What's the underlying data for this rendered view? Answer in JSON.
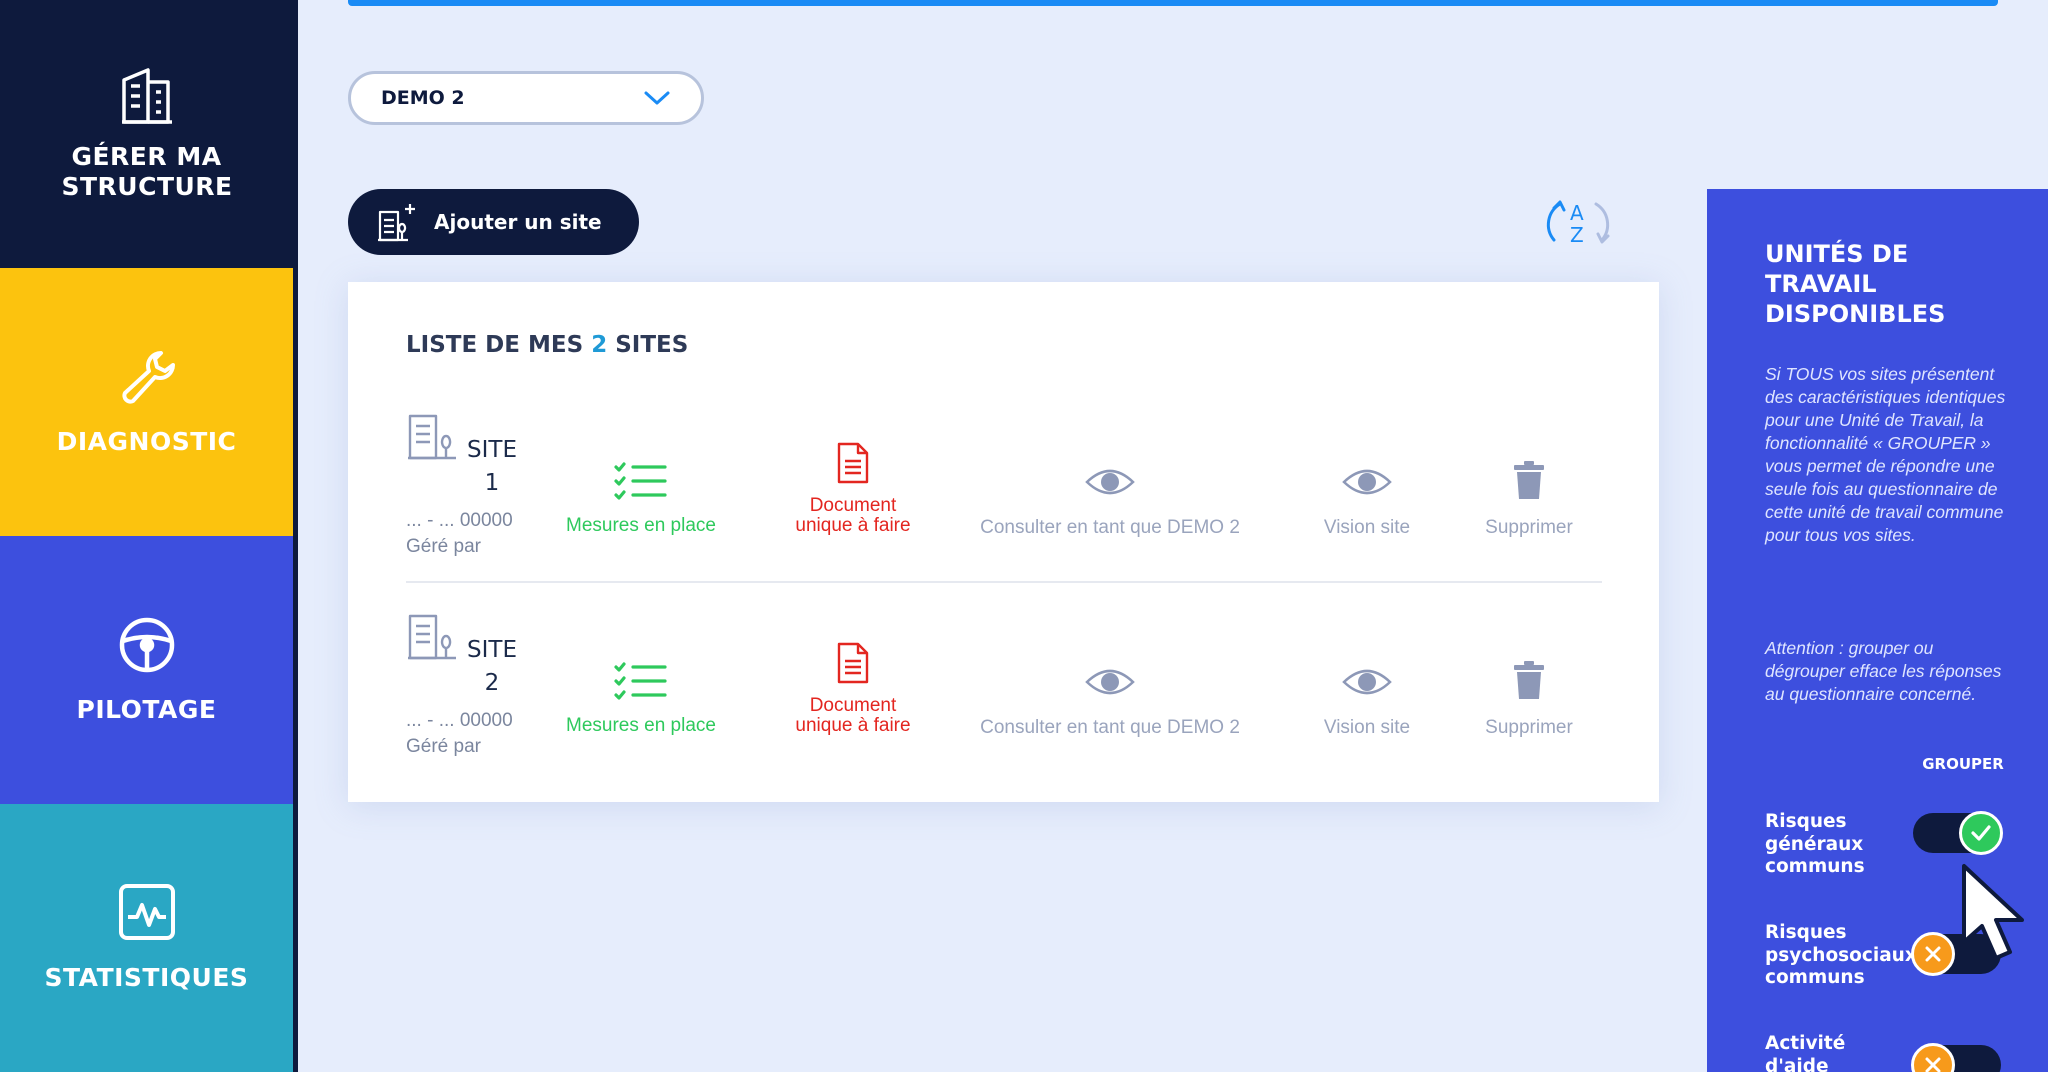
{
  "sidebar": {
    "items": [
      {
        "label": "GÉRER MA STRUCTURE",
        "icon": "building-icon",
        "color": "#0e1a3d"
      },
      {
        "label": "DIAGNOSTIC",
        "icon": "wrench-icon",
        "color": "#fcc30e"
      },
      {
        "label": "PILOTAGE",
        "icon": "steering-wheel-icon",
        "color": "#3d4fde"
      },
      {
        "label": "STATISTIQUES",
        "icon": "activity-chart-icon",
        "color": "#2aa7c4"
      }
    ]
  },
  "org_select": {
    "value": "DEMO 2"
  },
  "add_site": {
    "label": "Ajouter un site"
  },
  "list": {
    "title_prefix": "LISTE DE MES",
    "count": "2",
    "title_suffix": "SITES",
    "sites": [
      {
        "name": "SITE 1",
        "address": "... - ... 00000",
        "manager": "Géré par",
        "actions": {
          "mesures": "Mesures en place",
          "document": "Document unique à faire",
          "consult": "Consulter en tant que DEMO 2",
          "vision": "Vision site",
          "delete": "Supprimer"
        }
      },
      {
        "name": "SITE 2",
        "address": "... - ... 00000",
        "manager": "Géré par",
        "actions": {
          "mesures": "Mesures en place",
          "document": "Document unique à faire",
          "consult": "Consulter en tant que DEMO 2",
          "vision": "Vision site",
          "delete": "Supprimer"
        }
      }
    ]
  },
  "panel": {
    "title": "UNITÉS DE TRAVAIL DISPONIBLES",
    "description": "Si TOUS vos sites présentent des caractéristiques identiques pour une Unité de Travail, la fonctionnalité « GROUPER » vous permet de répondre une seule fois au questionnaire de cette unité de travail commune pour tous vos sites.",
    "warning": "Attention : grouper ou dégrouper efface les réponses au questionnaire concerné.",
    "group_header": "GROUPER",
    "units": [
      {
        "label": "Risques généraux communs",
        "grouped": true
      },
      {
        "label": "Risques psychosociaux communs",
        "grouped": false
      },
      {
        "label": "Activité d'aide dentaire",
        "grouped": false
      }
    ]
  }
}
